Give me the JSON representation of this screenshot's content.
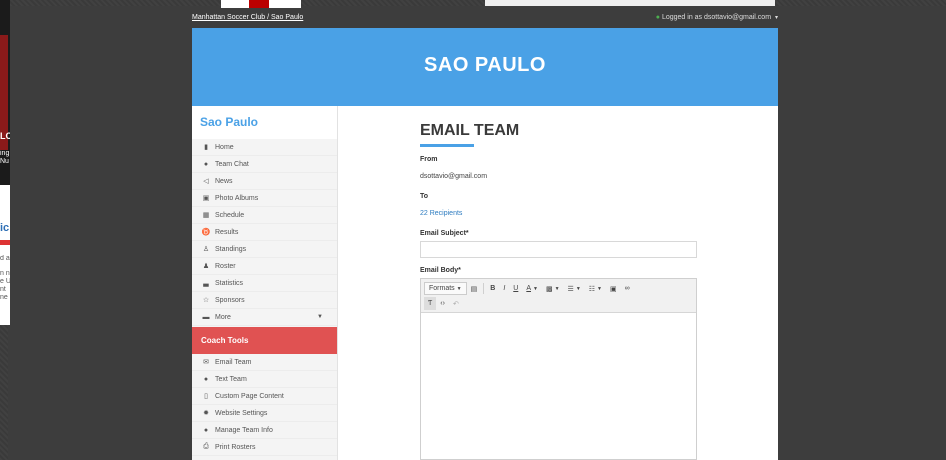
{
  "topbar": {
    "breadcrumb": "Manhattan Soccer Club / Sao Paulo",
    "login_text": "Logged in as dsottavio@gmail.com"
  },
  "banner": {
    "title": "SAO PAULO"
  },
  "sidebar": {
    "title": "Sao Paulo",
    "items": [
      {
        "label": "Home",
        "icon": "bar-chart-icon"
      },
      {
        "label": "Team Chat",
        "icon": "chat-icon"
      },
      {
        "label": "News",
        "icon": "megaphone-icon"
      },
      {
        "label": "Photo Albums",
        "icon": "image-icon"
      },
      {
        "label": "Schedule",
        "icon": "calendar-icon"
      },
      {
        "label": "Results",
        "icon": "trophy-icon"
      },
      {
        "label": "Standings",
        "icon": "sitemap-icon"
      },
      {
        "label": "Roster",
        "icon": "users-icon"
      },
      {
        "label": "Statistics",
        "icon": "stats-icon"
      },
      {
        "label": "Sponsors",
        "icon": "star-icon"
      },
      {
        "label": "More",
        "icon": "folder-icon"
      }
    ],
    "coach_tools_title": "Coach Tools",
    "coach_items": [
      {
        "label": "Email Team",
        "icon": "envelope-icon"
      },
      {
        "label": "Text Team",
        "icon": "comment-icon"
      },
      {
        "label": "Custom Page Content",
        "icon": "file-icon"
      },
      {
        "label": "Website Settings",
        "icon": "gear-icon"
      },
      {
        "label": "Manage Team Info",
        "icon": "info-icon"
      },
      {
        "label": "Print Rosters",
        "icon": "print-icon"
      }
    ]
  },
  "main": {
    "title": "EMAIL TEAM",
    "from_label": "From",
    "from_value": "dsottavio@gmail.com",
    "to_label": "To",
    "to_value": "22 Recipients",
    "subject_label": "Email Subject*",
    "subject_value": "",
    "body_label": "Email Body*",
    "toolbar": {
      "formats_label": "Formats"
    }
  },
  "colors": {
    "brand_blue": "#4aa1e6",
    "coach_red": "#e05252",
    "link_blue": "#2d7cc0"
  }
}
